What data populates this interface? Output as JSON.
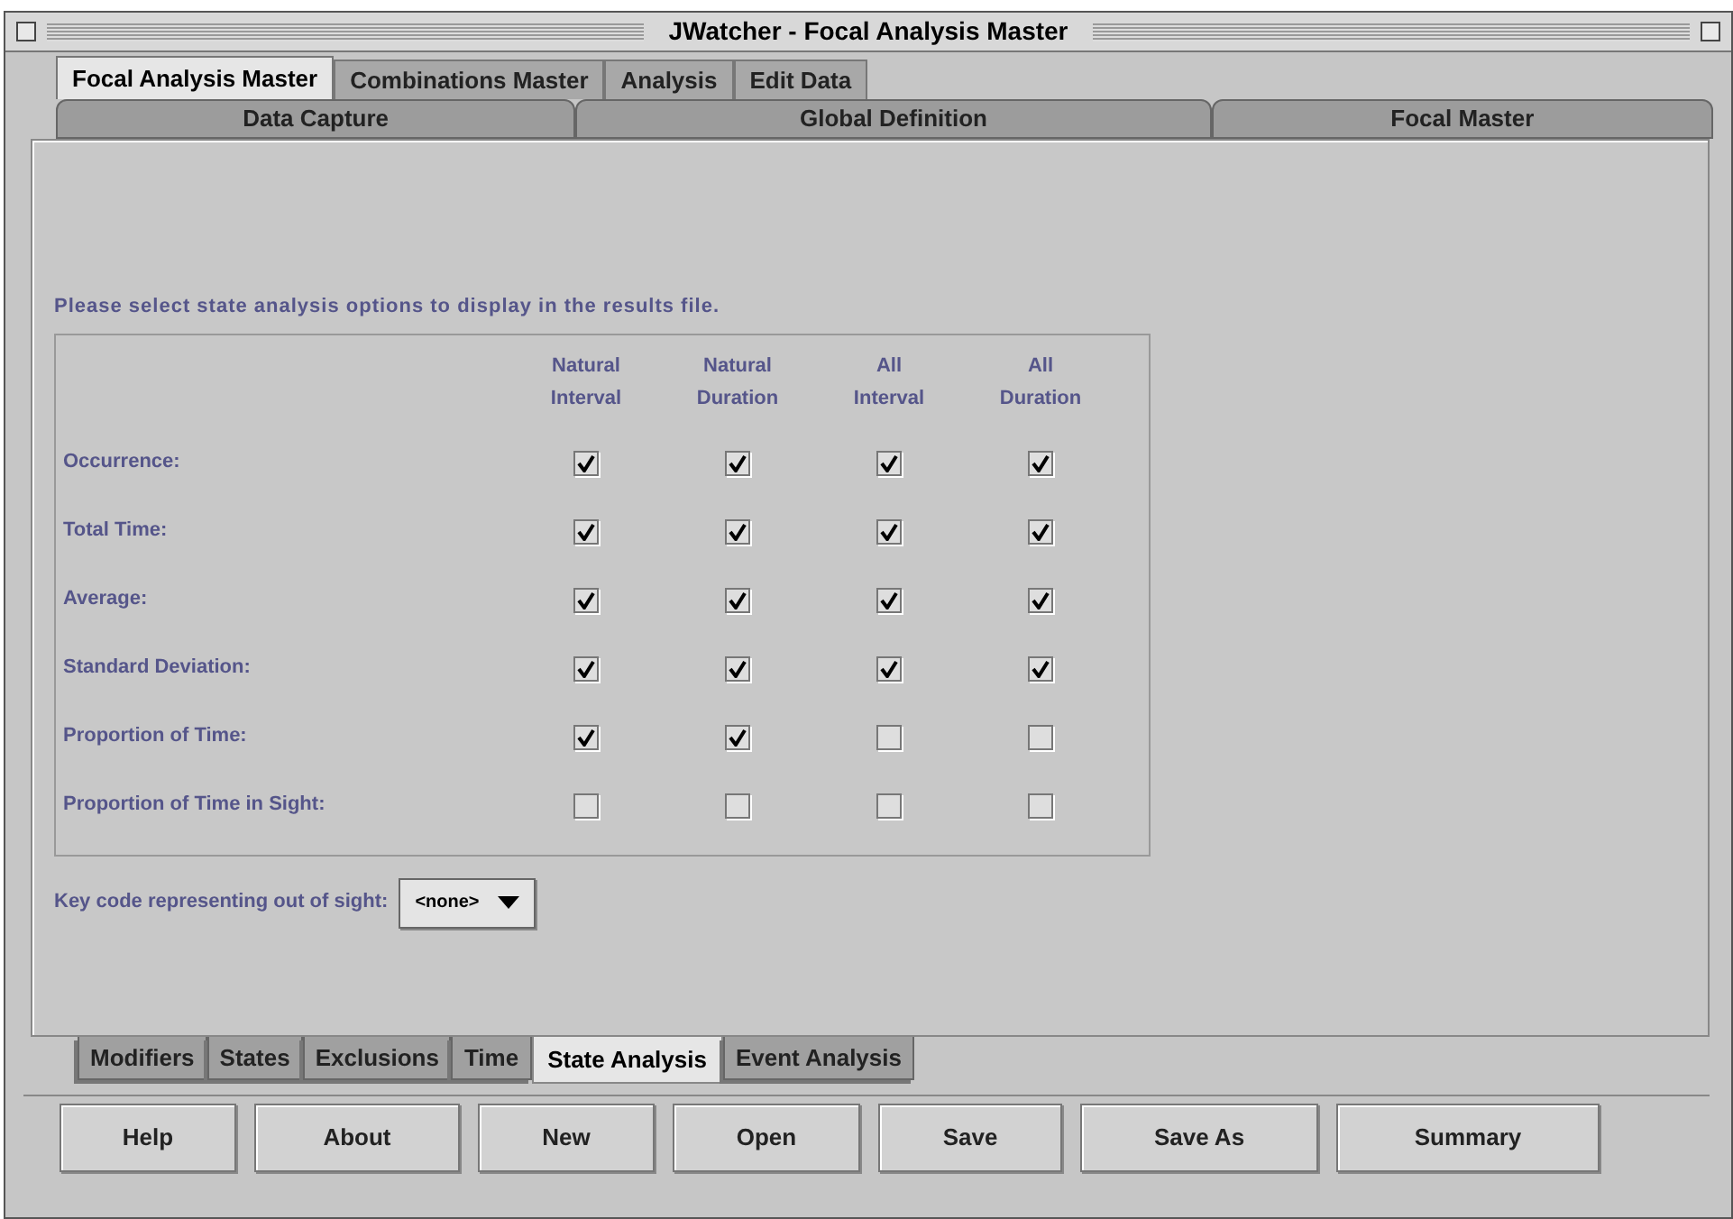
{
  "window": {
    "title": "JWatcher -  Focal Analysis Master"
  },
  "tabs": [
    {
      "label": "Focal Analysis Master",
      "selected": true
    },
    {
      "label": "Combinations Master",
      "selected": false
    },
    {
      "label": "Analysis",
      "selected": false
    },
    {
      "label": "Edit Data",
      "selected": false
    }
  ],
  "sub_tabs": [
    {
      "label": "Data Capture",
      "selected": false
    },
    {
      "label": "Global Definition",
      "selected": false
    },
    {
      "label": "Focal Master",
      "selected": false
    }
  ],
  "instruction": "Please select state analysis options to display in the results file.",
  "table": {
    "columns": [
      [
        "Natural",
        "Interval"
      ],
      [
        "Natural",
        "Duration"
      ],
      [
        "All",
        "Interval"
      ],
      [
        "All",
        "Duration"
      ]
    ],
    "rows": [
      {
        "label": "Occurrence:",
        "checked": [
          true,
          true,
          true,
          true
        ]
      },
      {
        "label": "Total Time:",
        "checked": [
          true,
          true,
          true,
          true
        ]
      },
      {
        "label": "Average:",
        "checked": [
          true,
          true,
          true,
          true
        ]
      },
      {
        "label": "Standard Deviation:",
        "checked": [
          true,
          true,
          true,
          true
        ]
      },
      {
        "label": "Proportion of Time:",
        "checked": [
          true,
          true,
          false,
          false
        ]
      },
      {
        "label": "Proportion of Time in Sight:",
        "checked": [
          false,
          false,
          false,
          false
        ]
      }
    ]
  },
  "key_code": {
    "label": "Key code representing out of sight:",
    "value": "<none>"
  },
  "bottom_tabs": [
    {
      "label": "Modifiers",
      "selected": false
    },
    {
      "label": "States",
      "selected": false
    },
    {
      "label": "Exclusions",
      "selected": false
    },
    {
      "label": "Time",
      "selected": false
    },
    {
      "label": "State Analysis",
      "selected": true
    },
    {
      "label": "Event Analysis",
      "selected": false
    }
  ],
  "buttons": [
    "Help",
    "About",
    "New",
    "Open",
    "Save",
    "Save As",
    "Summary"
  ]
}
